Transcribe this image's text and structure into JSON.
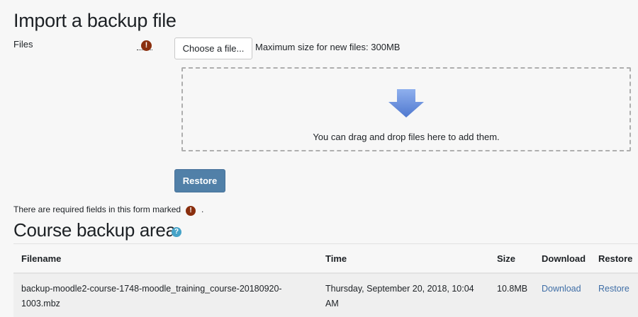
{
  "import": {
    "title": "Import a backup file",
    "files_label": "Files",
    "required_icon": "!",
    "choose_button": "Choose a file...",
    "max_size": "Maximum size for new files: 300MB",
    "drop_text": "You can drag and drop files here to add them.",
    "restore_button": "Restore",
    "required_note": "There are required fields in this form marked",
    "required_note_end": "."
  },
  "area": {
    "title": "Course backup area",
    "help_icon": "?",
    "columns": [
      "Filename",
      "Time",
      "Size",
      "Download",
      "Restore"
    ],
    "rows": [
      {
        "filename_line1": "backup-moodle2-course-1748-moodle_training_course-20180920-",
        "filename_line2": "1003.mbz",
        "time_line1": "Thursday, September 20, 2018, 10:04",
        "time_line2": "AM",
        "size": "10.8MB",
        "download": "Download",
        "restore": "Restore"
      }
    ]
  },
  "colors": {
    "primary_button": "#5180a8",
    "required_icon": "#8a2f0e",
    "help_icon": "#46a3c8",
    "link": "#3f6ea6",
    "arrow": "#6a8fd4"
  },
  "icons": {
    "required": "exclamation-circle-icon",
    "help": "question-circle-icon",
    "drop": "down-arrow-icon"
  }
}
